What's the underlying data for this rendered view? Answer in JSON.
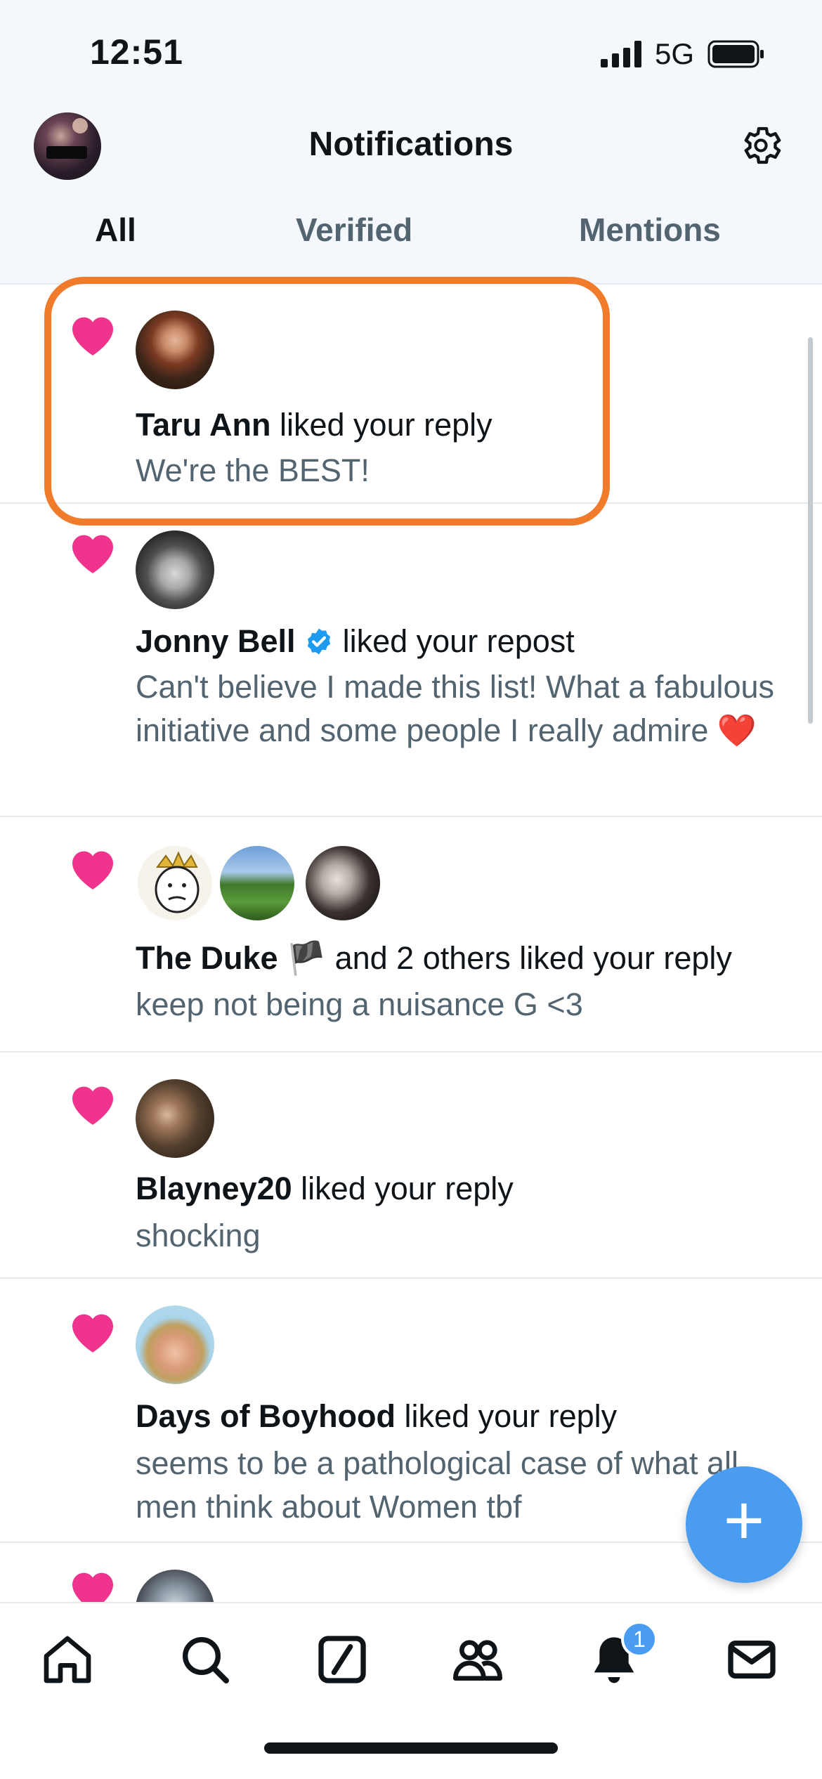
{
  "status": {
    "time": "12:51",
    "network": "5G"
  },
  "header": {
    "title": "Notifications"
  },
  "tabs": [
    {
      "label": "All"
    },
    {
      "label": "Verified"
    },
    {
      "label": "Mentions"
    }
  ],
  "notifications": [
    {
      "name": "Taru Ann",
      "action": "liked your reply",
      "text": "We're the BEST!"
    },
    {
      "name": "Jonny Bell",
      "verified": true,
      "action": "liked your repost",
      "text": "Can't believe I made this list! What a fabulous initiative and some people I really admire ❤️"
    },
    {
      "name": "The Duke 🏴",
      "action": "and 2 others liked your reply",
      "text": "keep not being a nuisance G <3"
    },
    {
      "name": "Blayney20",
      "action": "liked your reply",
      "text": "shocking"
    },
    {
      "name": "Days of Boyhood",
      "action": "liked your reply",
      "text": "seems to be a pathological case of what all men think about Women tbf"
    }
  ],
  "fab": {
    "label": "+"
  },
  "tabbar": {
    "notification_badge": "1"
  },
  "colors": {
    "accent": "#4a9cf0",
    "heart": "#f0338c",
    "highlight": "#f07b2b",
    "verified": "#1d9bf0"
  }
}
